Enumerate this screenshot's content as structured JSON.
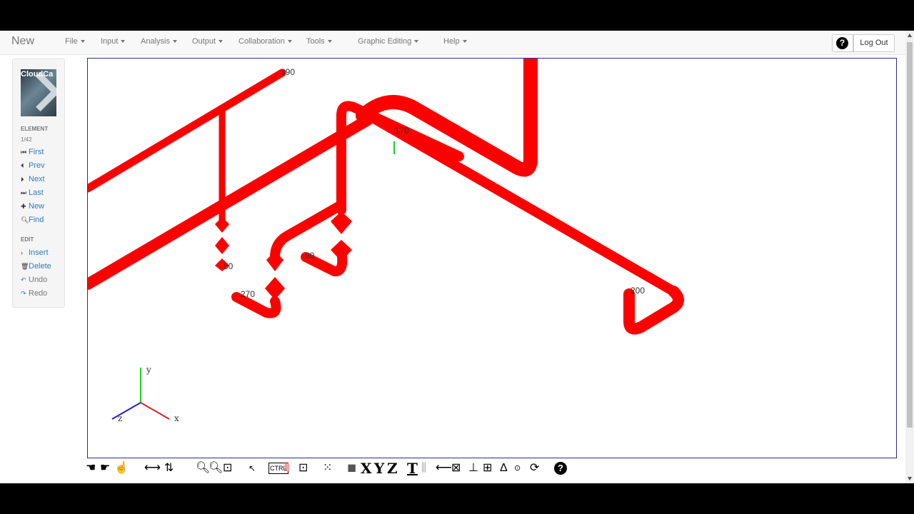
{
  "brand": "New",
  "menu": [
    {
      "label": "File"
    },
    {
      "label": "Input"
    },
    {
      "label": "Analysis"
    },
    {
      "label": "Output"
    },
    {
      "label": "Collaboration"
    },
    {
      "label": "Tools"
    },
    {
      "label": "Graphic Editing"
    },
    {
      "label": "Help"
    }
  ],
  "header": {
    "help_icon": "?",
    "logout": "Log Out"
  },
  "sidebar": {
    "logo_text": "CloudCa",
    "element_label": "ELEMENT",
    "element_counter": "1/42",
    "nav": [
      {
        "label": "First",
        "icon": "fast-backward-icon"
      },
      {
        "label": "Prev",
        "icon": "step-backward-icon"
      },
      {
        "label": "Next",
        "icon": "step-forward-icon"
      },
      {
        "label": "Last",
        "icon": "fast-forward-icon"
      },
      {
        "label": "New",
        "icon": "plus-icon"
      },
      {
        "label": "Find",
        "icon": "search-icon"
      }
    ],
    "edit_label": "EDIT",
    "edit": [
      {
        "label": "Insert",
        "icon": "chevron-right-icon"
      },
      {
        "label": "Delete",
        "icon": "trash-icon"
      },
      {
        "label": "Undo",
        "icon": "undo-icon"
      },
      {
        "label": "Redo",
        "icon": "redo-icon"
      }
    ]
  },
  "viewport": {
    "node_labels": [
      "390",
      "170",
      "50",
      "90",
      "270",
      "200"
    ],
    "axes": {
      "x": "x",
      "y": "y",
      "z": "z"
    },
    "pipe_color": "#ff0000"
  },
  "toolbar": {
    "axis_x": "X",
    "axis_y": "Y",
    "axis_z": "Z",
    "text_tool": "T",
    "ctrl_label": "CTRL",
    "help_icon": "?"
  }
}
